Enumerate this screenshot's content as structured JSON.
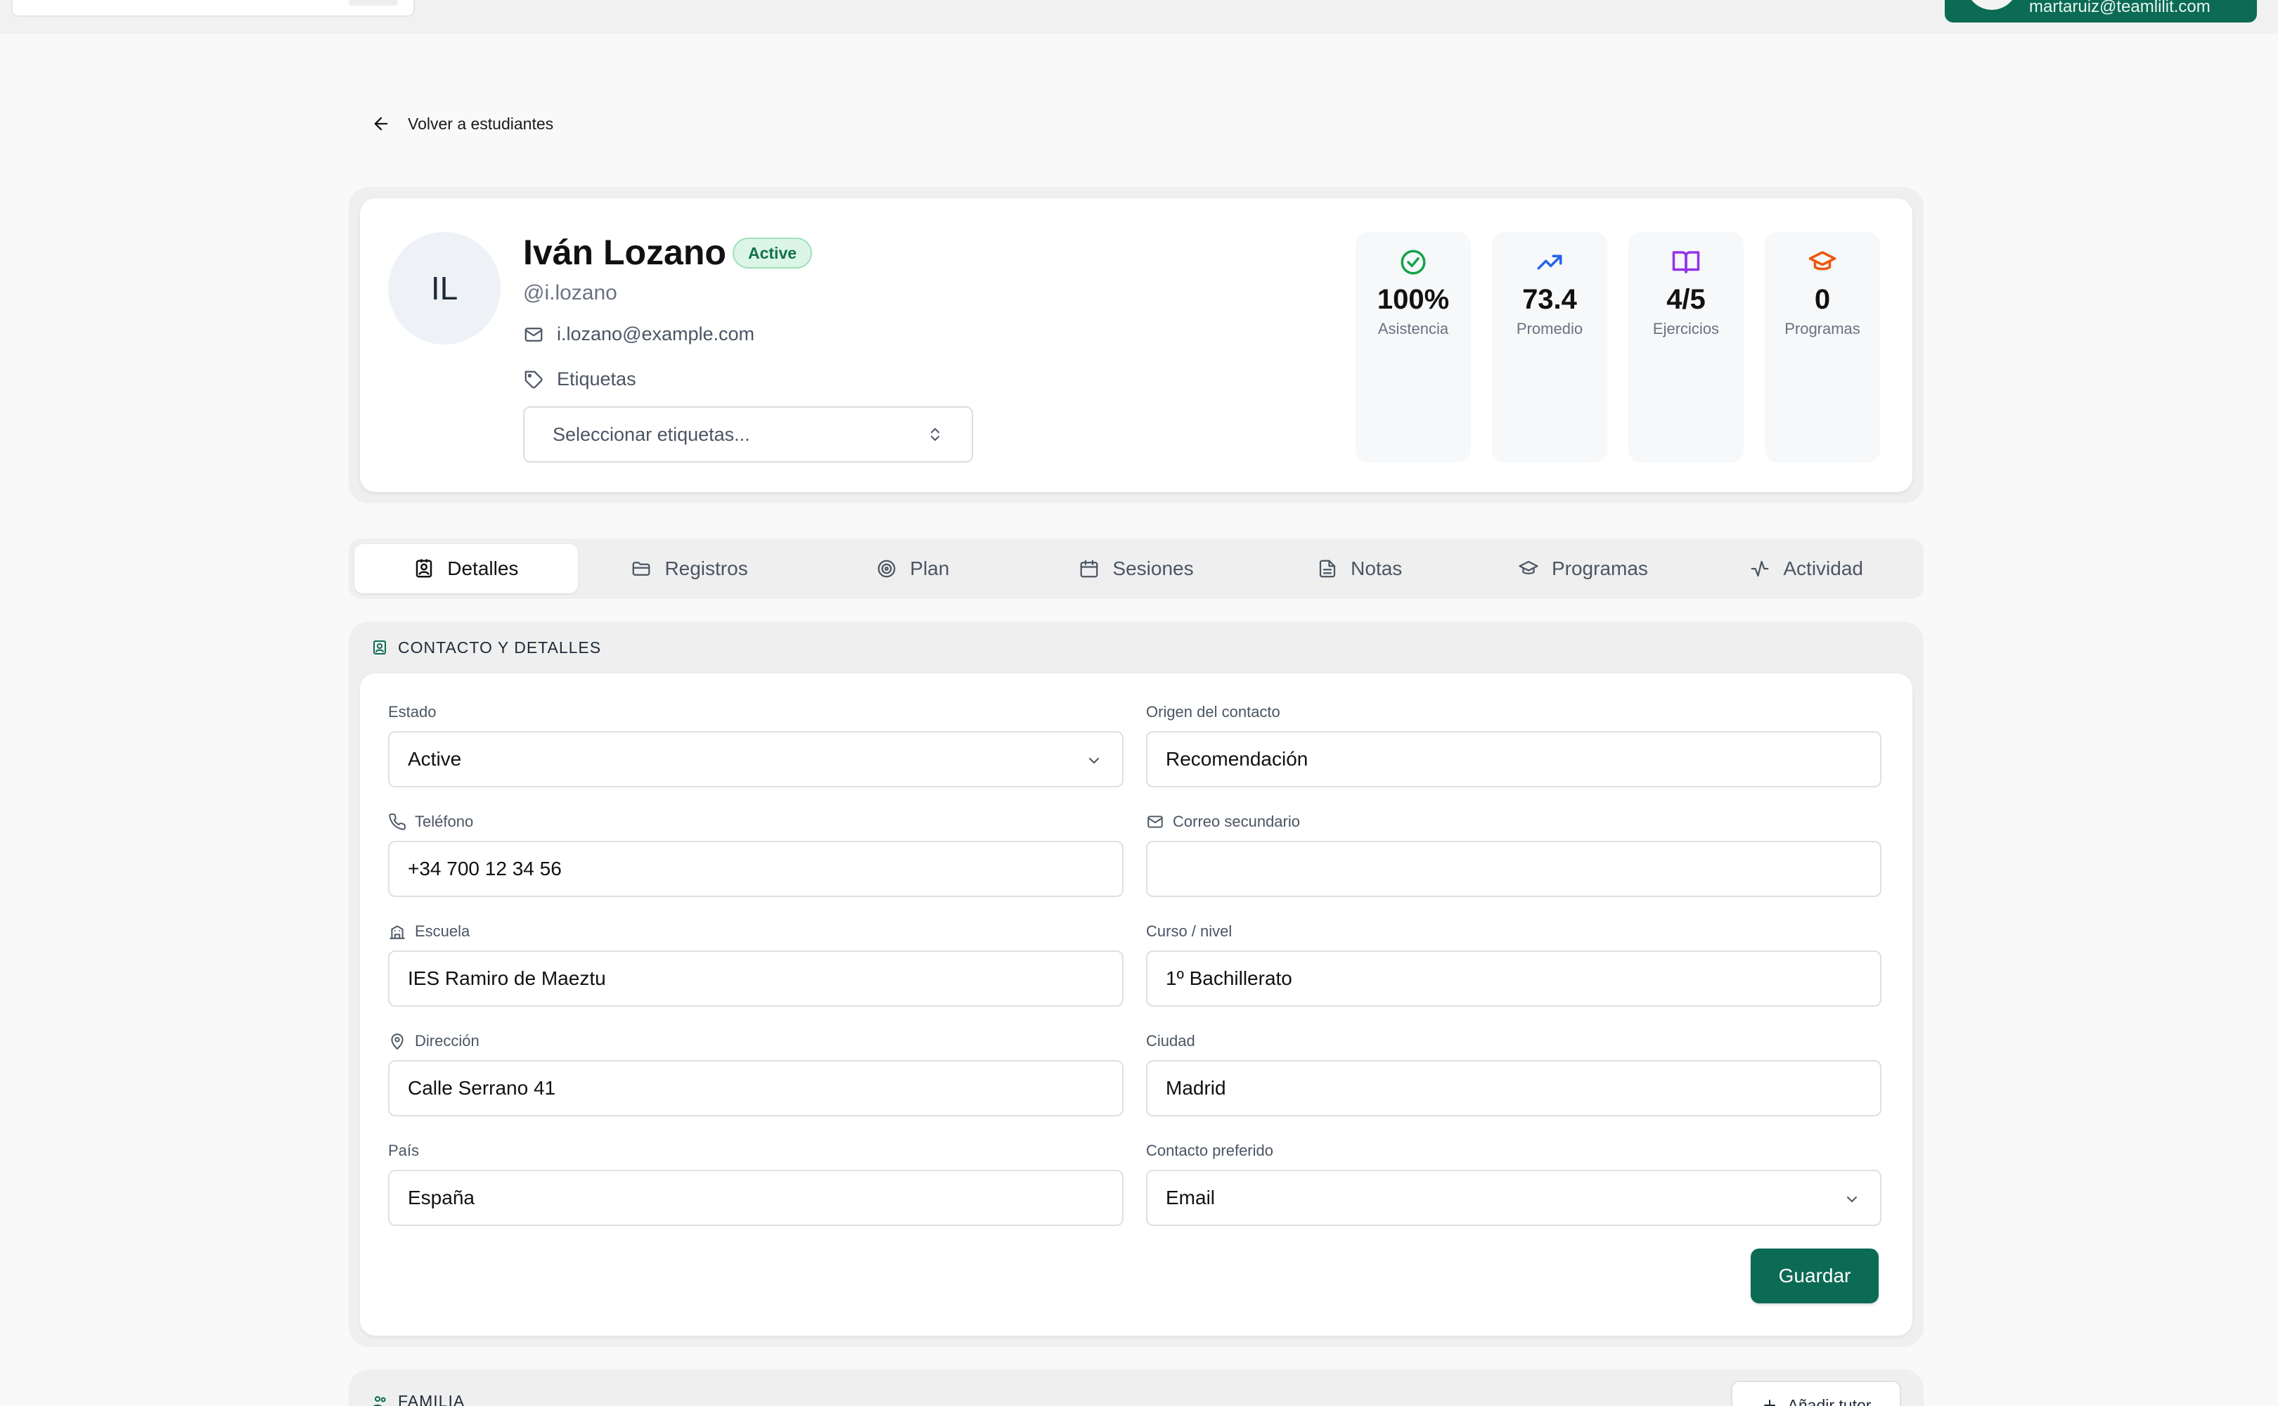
{
  "topbar": {
    "user_email": "martaruiz@teamlilit.com"
  },
  "back_link": {
    "label": "Volver a estudiantes"
  },
  "student": {
    "initials": "IL",
    "name": "Iván Lozano",
    "status_badge": "Active",
    "handle": "@i.lozano",
    "email": "i.lozano@example.com",
    "tags_label": "Etiquetas",
    "tags_placeholder": "Seleccionar etiquetas..."
  },
  "stats": [
    {
      "value": "100%",
      "label": "Asistencia",
      "icon": "check-circle-icon",
      "color": "#16a34a"
    },
    {
      "value": "73.4",
      "label": "Promedio",
      "icon": "trending-up-icon",
      "color": "#2563eb"
    },
    {
      "value": "4/5",
      "label": "Ejercicios",
      "icon": "book-open-icon",
      "color": "#9333ea"
    },
    {
      "value": "0",
      "label": "Programas",
      "icon": "graduation-cap-icon",
      "color": "#ea580c"
    }
  ],
  "tabs": [
    {
      "label": "Detalles",
      "icon": "contact-icon",
      "active": true
    },
    {
      "label": "Registros",
      "icon": "folder-icon"
    },
    {
      "label": "Plan",
      "icon": "target-icon"
    },
    {
      "label": "Sesiones",
      "icon": "calendar-icon"
    },
    {
      "label": "Notas",
      "icon": "file-text-icon"
    },
    {
      "label": "Programas",
      "icon": "graduation-cap-icon"
    },
    {
      "label": "Actividad",
      "icon": "activity-icon"
    }
  ],
  "details": {
    "section_title": "CONTACTO Y DETALLES",
    "fields": {
      "estado": {
        "label": "Estado",
        "value": "Active"
      },
      "origen": {
        "label": "Origen del contacto",
        "value": "Recomendación"
      },
      "telefono": {
        "label": "Teléfono",
        "value": "+34 700 12 34 56"
      },
      "correo_sec": {
        "label": "Correo secundario",
        "value": ""
      },
      "escuela": {
        "label": "Escuela",
        "value": "IES Ramiro de Maeztu"
      },
      "curso": {
        "label": "Curso / nivel",
        "value": "1º Bachillerato"
      },
      "direccion": {
        "label": "Dirección",
        "value": "Calle Serrano 41"
      },
      "ciudad": {
        "label": "Ciudad",
        "value": "Madrid"
      },
      "pais": {
        "label": "País",
        "value": "España"
      },
      "contacto_pref": {
        "label": "Contacto preferido",
        "value": "Email"
      }
    },
    "save_label": "Guardar"
  },
  "family": {
    "section_title": "FAMILIA",
    "add_label": "Añadir tutor"
  },
  "colors": {
    "accent": "#0c6b54",
    "badge_bg": "#dcf5e6",
    "badge_text": "#12724a"
  }
}
